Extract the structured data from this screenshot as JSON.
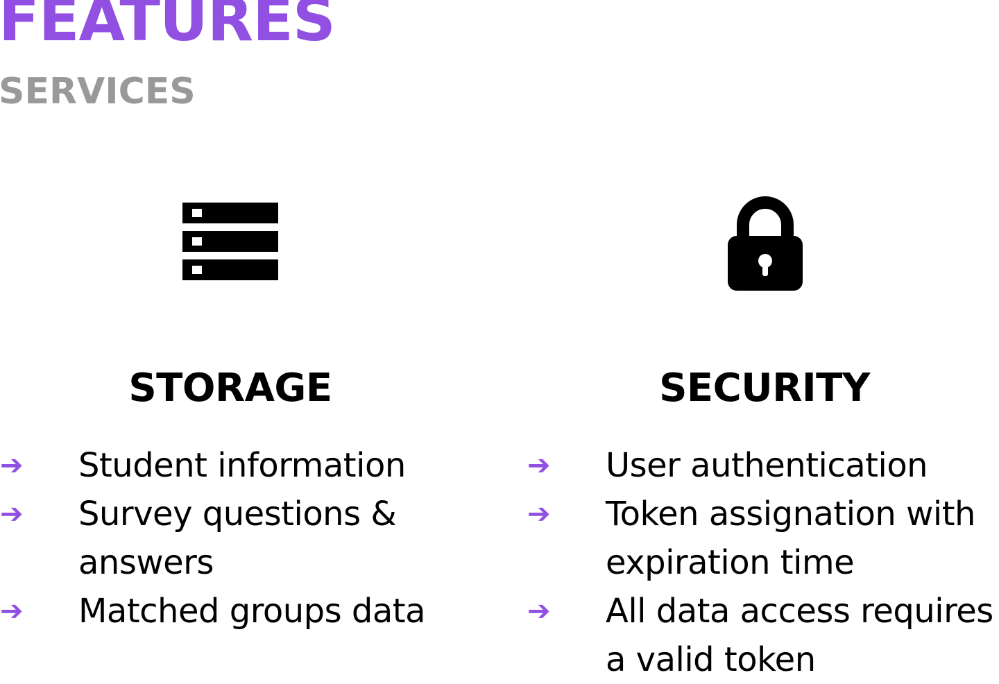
{
  "colors": {
    "accent": "#9150e2",
    "subtitle": "#999999",
    "text": "#000000"
  },
  "header": {
    "title": "FEATURES",
    "subtitle": "SERVICES"
  },
  "columns": [
    {
      "icon": "server-stack-icon",
      "heading": "STORAGE",
      "items": [
        "Student information",
        "Survey questions &",
        "answers",
        "Matched groups data"
      ],
      "bullets": [
        "➔",
        "➔",
        "",
        "➔"
      ]
    },
    {
      "icon": "lock-icon",
      "heading": "SECURITY",
      "items": [
        "User authentication",
        "Token assignation with",
        "expiration time",
        "All data access requires",
        "a valid token"
      ],
      "bullets": [
        "➔",
        "➔",
        "",
        "➔",
        ""
      ]
    }
  ]
}
